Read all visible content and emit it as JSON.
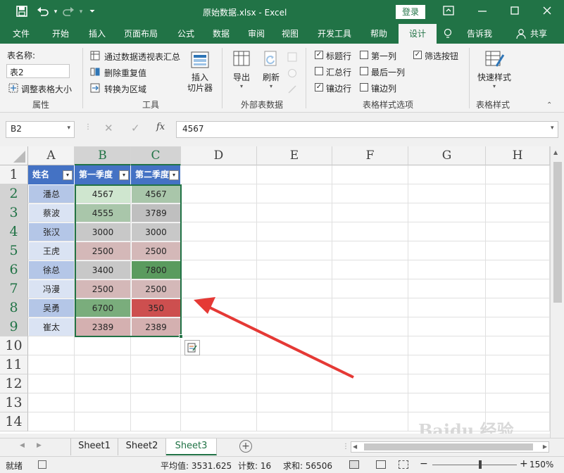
{
  "titlebar": {
    "title": "原始数据.xlsx  -  Excel",
    "login": "登录",
    "save_icon": "save-icon",
    "undo_icon": "undo-icon",
    "redo_icon": "redo-icon",
    "customize_icon": "customize-qat-icon"
  },
  "tabs": [
    "文件",
    "开始",
    "插入",
    "页面布局",
    "公式",
    "数据",
    "审阅",
    "视图",
    "开发工具",
    "帮助",
    "设计",
    "告诉我",
    "共享"
  ],
  "ribbon": {
    "properties": {
      "label": "表名称:",
      "table_name": "表2",
      "resize": "调整表格大小",
      "group": "属性"
    },
    "tools": {
      "pivot": "通过数据透视表汇总",
      "dedupe": "删除重复值",
      "convert": "转换为区域",
      "slicer": "插入\n切片器",
      "slicer_1": "插入",
      "slicer_2": "切片器",
      "group": "工具"
    },
    "external": {
      "export": "导出",
      "refresh": "刷新",
      "group": "外部表数据"
    },
    "style_options": {
      "header_row": "标题行",
      "total_row": "汇总行",
      "banded_rows": "镶边行",
      "first_col": "第一列",
      "last_col": "最后一列",
      "banded_cols": "镶边列",
      "filter_btn": "筛选按钮",
      "group": "表格样式选项",
      "checked": {
        "header_row": true,
        "total_row": false,
        "banded_rows": true,
        "first_col": false,
        "last_col": false,
        "banded_cols": false,
        "filter_btn": true
      }
    },
    "styles": {
      "quick": "快速样式",
      "group": "表格样式"
    }
  },
  "formula_bar": {
    "name_box": "B2",
    "formula": "4567"
  },
  "columns": [
    "A",
    "B",
    "C",
    "D",
    "E",
    "F",
    "G",
    "H"
  ],
  "rows": [
    "1",
    "2",
    "3",
    "4",
    "5",
    "6",
    "7",
    "8",
    "9",
    "10",
    "11",
    "12",
    "13",
    "14"
  ],
  "table": {
    "headers": [
      "姓名",
      "第一季度",
      "第二季度"
    ],
    "rows": [
      {
        "name": "潘总",
        "q1": "4567",
        "q2": "4567",
        "q1_color": "#cfe6cf",
        "q2_color": "#a9c6aa"
      },
      {
        "name": "蔡波",
        "q1": "4555",
        "q2": "3789",
        "q1_color": "#a9c6aa",
        "q2_color": "#bfbfbf"
      },
      {
        "name": "张汉",
        "q1": "3000",
        "q2": "3000",
        "q1_color": "#c8c8c8",
        "q2_color": "#c8c8c8"
      },
      {
        "name": "王虎",
        "q1": "2500",
        "q2": "2500",
        "q1_color": "#d4b8b8",
        "q2_color": "#d4b8b8"
      },
      {
        "name": "徐总",
        "q1": "3400",
        "q2": "7800",
        "q1_color": "#c8c8c8",
        "q2_color": "#5a9b5e"
      },
      {
        "name": "冯漫",
        "q1": "2500",
        "q2": "2500",
        "q1_color": "#d4b8b8",
        "q2_color": "#d4b8b8"
      },
      {
        "name": "吴勇",
        "q1": "6700",
        "q2": "350",
        "q1_color": "#7aad7c",
        "q2_color": "#cd4f4f"
      },
      {
        "name": "崔太",
        "q1": "2389",
        "q2": "2389",
        "q1_color": "#d4b0b0",
        "q2_color": "#d4b0b0"
      }
    ],
    "name_band_colors": [
      "#b4c6e7",
      "#dae3f3"
    ]
  },
  "sheets": [
    "Sheet1",
    "Sheet2",
    "Sheet3"
  ],
  "active_sheet": "Sheet3",
  "status": {
    "ready": "就绪",
    "average": "平均值: 3531.625",
    "count": "计数: 16",
    "sum": "求和: 56506",
    "zoom": "150%"
  },
  "watermark": "Baidu 经验 jingyan.baidu.com"
}
